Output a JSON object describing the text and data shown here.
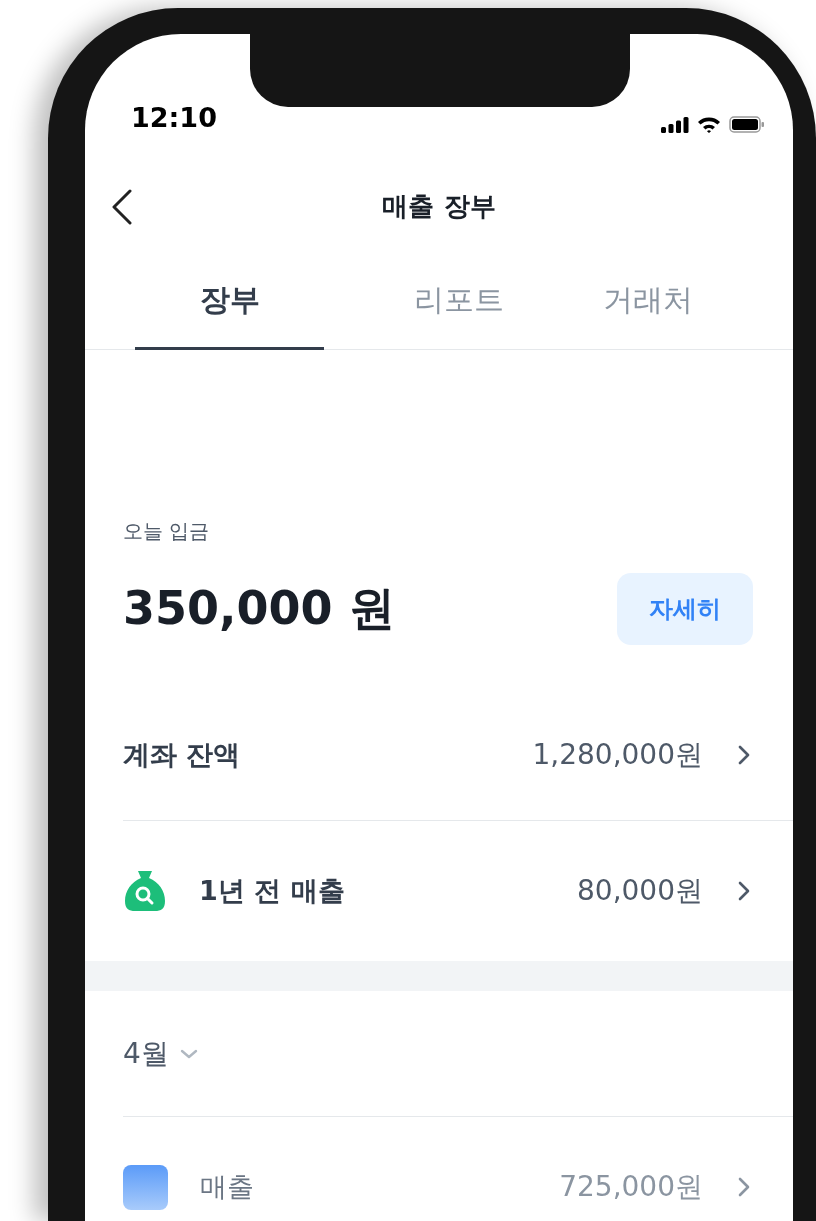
{
  "status_bar": {
    "time": "12:10"
  },
  "header": {
    "title": "매출 장부"
  },
  "tabs": [
    {
      "label": "장부",
      "selected": true
    },
    {
      "label": "리포트",
      "selected": false
    },
    {
      "label": "거래처",
      "selected": false
    }
  ],
  "summary": {
    "label": "오늘 입금",
    "amount": "350,000 원",
    "button": "자세히"
  },
  "rows": [
    {
      "kind": "plain",
      "label": "계좌 잔액",
      "value": "1,280,000원",
      "muted": false
    },
    {
      "kind": "bag",
      "label": "1년 전 매출",
      "value": "80,000원",
      "muted": false
    }
  ],
  "month": {
    "label": "4월"
  },
  "list": [
    {
      "kind": "square",
      "label": "매출",
      "value": "725,000원",
      "muted": true
    }
  ]
}
